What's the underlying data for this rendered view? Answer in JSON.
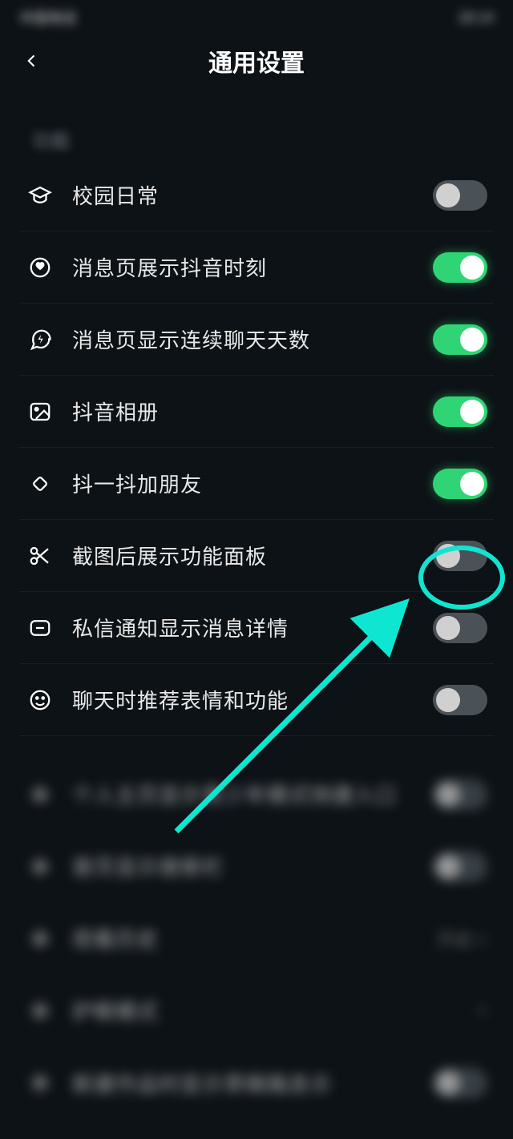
{
  "statusBar": {
    "carrier": "中国电信",
    "time": "18:14"
  },
  "header": {
    "title": "通用设置"
  },
  "section": {
    "label": "功能"
  },
  "rows": [
    {
      "icon": "graduation-cap-icon",
      "label": "校园日常",
      "on": false,
      "blurred": false
    },
    {
      "icon": "heart-target-icon",
      "label": "消息页展示抖音时刻",
      "on": true,
      "blurred": false
    },
    {
      "icon": "lightning-bubble-icon",
      "label": "消息页显示连续聊天天数",
      "on": true,
      "blurred": false
    },
    {
      "icon": "image-icon",
      "label": "抖音相册",
      "on": true,
      "blurred": false
    },
    {
      "icon": "rotate-diamond-icon",
      "label": "抖一抖加朋友",
      "on": true,
      "blurred": false
    },
    {
      "icon": "scissors-icon",
      "label": "截图后展示功能面板",
      "on": false,
      "blurred": false
    },
    {
      "icon": "message-minus-icon",
      "label": "私信通知显示消息详情",
      "on": false,
      "blurred": false
    },
    {
      "icon": "smiley-icon",
      "label": "聊天时推荐表情和功能",
      "on": false,
      "blurred": false
    }
  ],
  "blurredRows": [
    {
      "label": "个人主页显示青少年模式快捷入口",
      "toggle": true
    },
    {
      "label": "首页显示搜索栏",
      "toggle": true
    },
    {
      "label": "观看历史",
      "toggle": false
    },
    {
      "label": "护眼模式",
      "toggle": false
    },
    {
      "label": "新建作品时显示草稿箱息示",
      "toggle": false
    }
  ],
  "annotation": {
    "highlightIndex": 5
  }
}
